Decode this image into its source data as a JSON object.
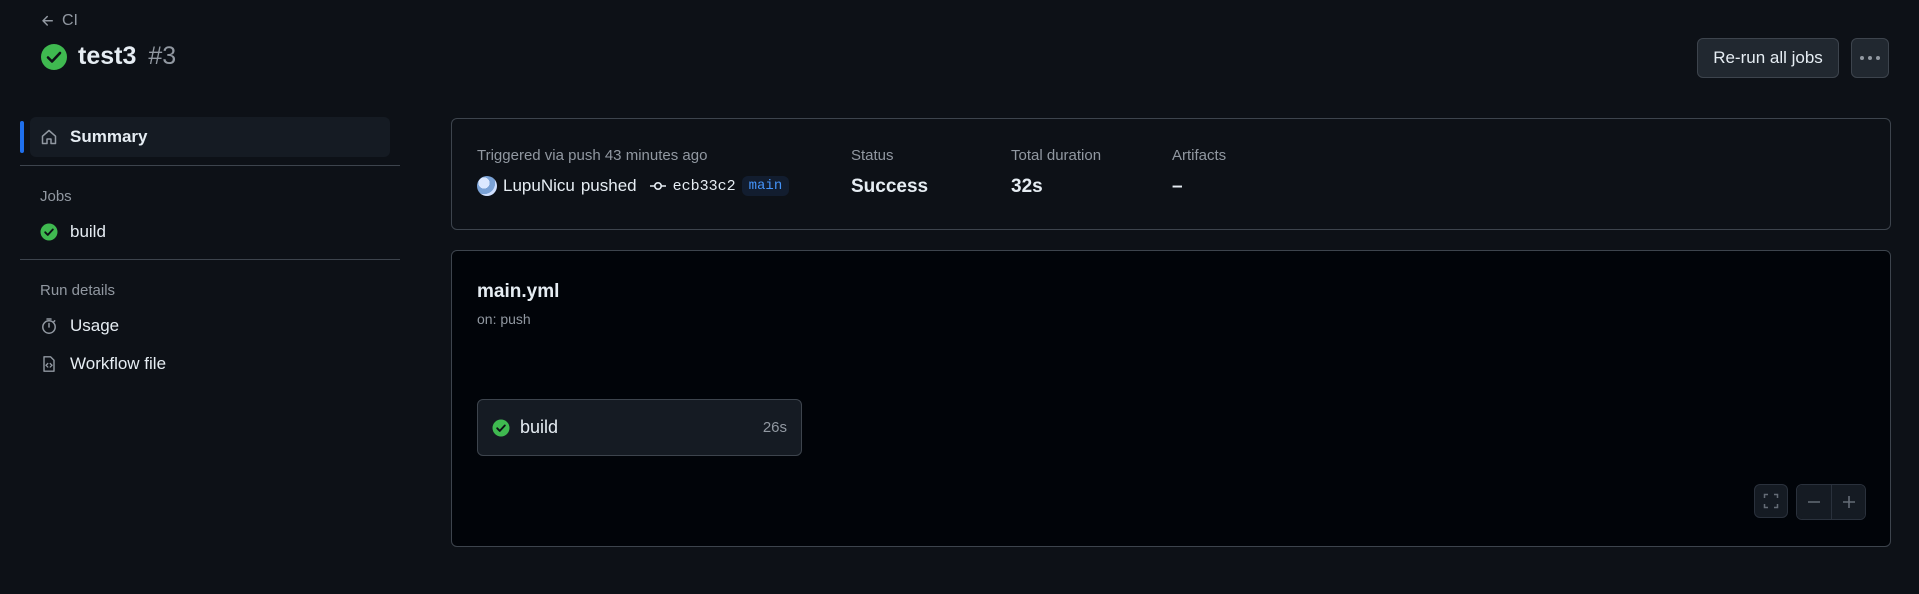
{
  "header": {
    "back_label": "CI",
    "run_title": "test3",
    "run_number": "#3",
    "rerun_label": "Re-run all jobs"
  },
  "sidebar": {
    "summary_label": "Summary",
    "jobs_heading": "Jobs",
    "jobs": [
      {
        "label": "build",
        "status": "success"
      }
    ],
    "details_heading": "Run details",
    "details": [
      {
        "label": "Usage",
        "icon": "stopwatch-icon"
      },
      {
        "label": "Workflow file",
        "icon": "file-code-icon"
      }
    ]
  },
  "summary": {
    "trigger_label": "Triggered via push 43 minutes ago",
    "actor": "LupuNicu",
    "action": "pushed",
    "commit_sha": "ecb33c2",
    "branch": "main",
    "status_label": "Status",
    "status_value": "Success",
    "duration_label": "Total duration",
    "duration_value": "32s",
    "artifacts_label": "Artifacts",
    "artifacts_value": "–"
  },
  "graph": {
    "workflow_file": "main.yml",
    "trigger": "on: push",
    "job": {
      "name": "build",
      "duration": "26s"
    }
  },
  "colors": {
    "background": "#0d1117",
    "success": "#3fb950",
    "accent": "#1f6feb",
    "border": "#3d444d"
  }
}
